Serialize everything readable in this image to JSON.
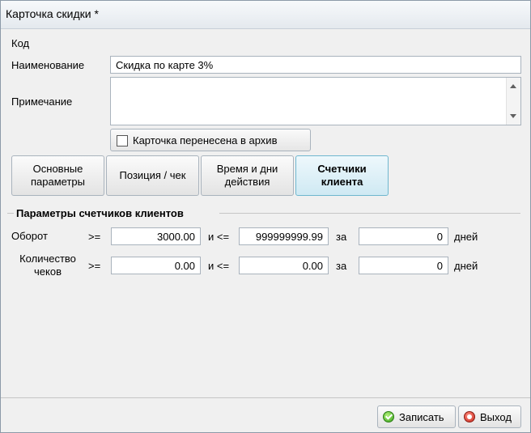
{
  "window": {
    "title": "Карточка скидки *"
  },
  "form": {
    "code_label": "Код",
    "name_label": "Наименование",
    "name_value": "Скидка по карте 3%",
    "note_label": "Примечание",
    "note_value": "",
    "archive_label": "Карточка перенесена в архив",
    "archive_checked": false
  },
  "tabs": [
    {
      "label": "Основные параметры",
      "active": false
    },
    {
      "label": "Позиция / чек",
      "active": false
    },
    {
      "label": "Время и дни действия",
      "active": false
    },
    {
      "label": "Счетчики клиента",
      "active": true
    }
  ],
  "counters": {
    "section_title": "Параметры счетчиков клиентов",
    "rows": [
      {
        "label": "Оборот",
        "op1": ">=",
        "from": "3000.00",
        "and_op": "и <=",
        "to": "999999999.99",
        "za": "за",
        "days": "0",
        "days_label": "дней"
      },
      {
        "label": "Количество чеков",
        "op1": ">=",
        "from": "0.00",
        "and_op": "и <=",
        "to": "0.00",
        "za": "за",
        "days": "0",
        "days_label": "дней"
      }
    ]
  },
  "footer": {
    "save_label": "Записать",
    "exit_label": "Выход"
  }
}
